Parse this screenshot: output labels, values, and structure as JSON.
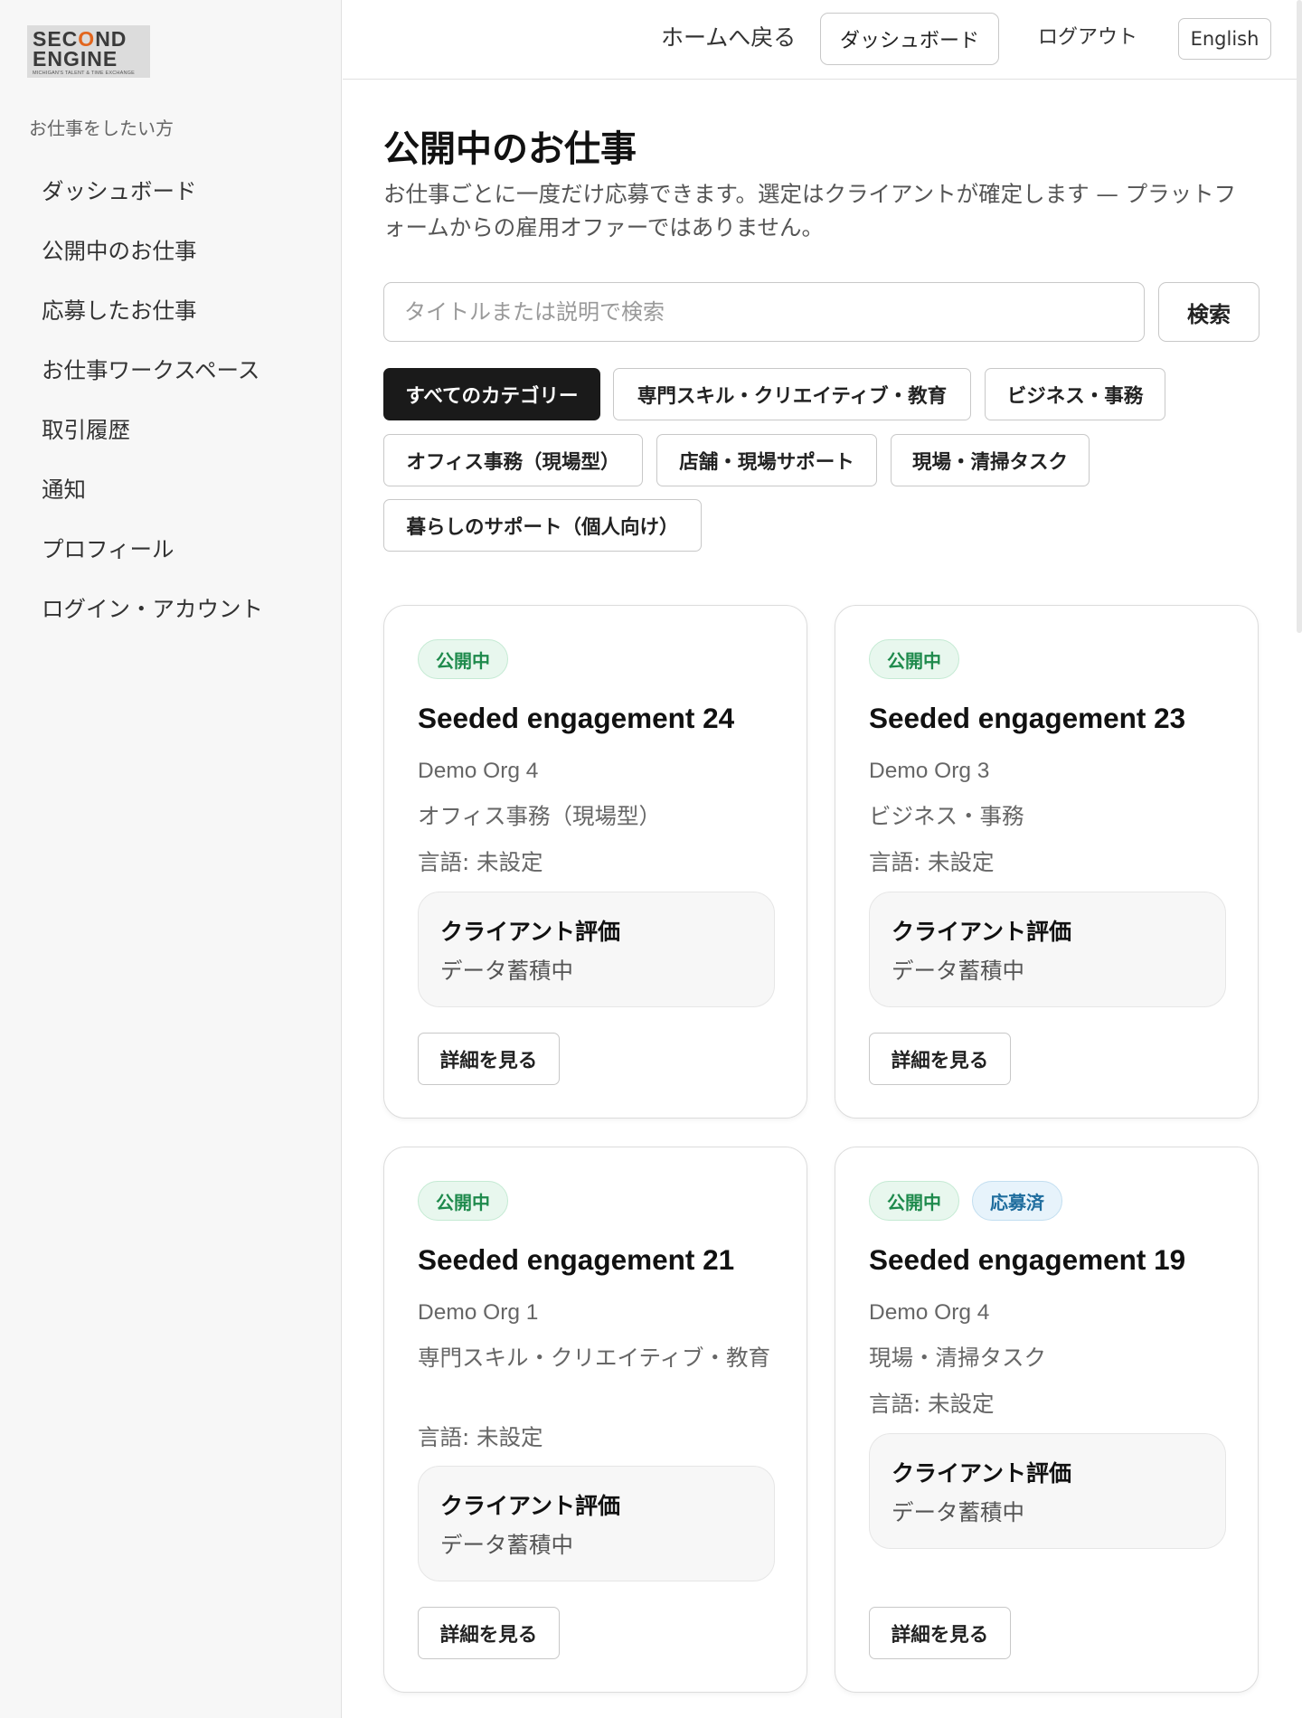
{
  "brand": {
    "line1_a": "SEC",
    "line1_o": "O",
    "line1_b": "ND",
    "line2": "ENGINE",
    "tagline": "MICHIGAN'S TALENT & TIME EXCHANGE"
  },
  "sidebar": {
    "section_label": "お仕事をしたい方",
    "items": [
      {
        "label": "ダッシュボード"
      },
      {
        "label": "公開中のお仕事"
      },
      {
        "label": "応募したお仕事"
      },
      {
        "label": "お仕事ワークスペース"
      },
      {
        "label": "取引履歴"
      },
      {
        "label": "通知"
      },
      {
        "label": "プロフィール"
      },
      {
        "label": "ログイン・アカウント"
      }
    ]
  },
  "topbar": {
    "home_link": "ホームへ戻る",
    "dashboard_button": "ダッシュボード",
    "logout": "ログアウト",
    "language_button": "English"
  },
  "page": {
    "title": "公開中のお仕事",
    "description": "お仕事ごとに一度だけ応募できます。選定はクライアントが確定します — プラットフォームからの雇用オファーではありません。"
  },
  "search": {
    "placeholder": "タイトルまたは説明で検索",
    "value": "",
    "button_label": "検索"
  },
  "categories": [
    {
      "label": "すべてのカテゴリー",
      "active": true
    },
    {
      "label": "専門スキル・クリエイティブ・教育",
      "active": false
    },
    {
      "label": "ビジネス・事務",
      "active": false
    },
    {
      "label": "オフィス事務（現場型）",
      "active": false
    },
    {
      "label": "店舗・現場サポート",
      "active": false
    },
    {
      "label": "現場・清掃タスク",
      "active": false
    },
    {
      "label": "暮らしのサポート（個人向け）",
      "active": false
    }
  ],
  "jobs": [
    {
      "badges": [
        "公開中"
      ],
      "title": "Seeded engagement 24",
      "org": "Demo Org 4",
      "category": "オフィス事務（現場型）",
      "language": "言語: 未設定",
      "rating_label": "クライアント評価",
      "rating_value": "データ蓄積中",
      "detail_button": "詳細を見る"
    },
    {
      "badges": [
        "公開中"
      ],
      "title": "Seeded engagement 23",
      "org": "Demo Org 3",
      "category": "ビジネス・事務",
      "language": "言語: 未設定",
      "rating_label": "クライアント評価",
      "rating_value": "データ蓄積中",
      "detail_button": "詳細を見る"
    },
    {
      "badges": [
        "公開中"
      ],
      "title": "Seeded engagement 21",
      "org": "Demo Org 1",
      "category": "専門スキル・クリエイティブ・教育",
      "language": "言語: 未設定",
      "rating_label": "クライアント評価",
      "rating_value": "データ蓄積中",
      "detail_button": "詳細を見る"
    },
    {
      "badges": [
        "公開中",
        "応募済"
      ],
      "title": "Seeded engagement 19",
      "org": "Demo Org 4",
      "category": "現場・清掃タスク",
      "language": "言語: 未設定",
      "rating_label": "クライアント評価",
      "rating_value": "データ蓄積中",
      "detail_button": "詳細を見る"
    }
  ],
  "colors": {
    "active_chip_bg": "#1a1a1a",
    "open_badge": "#1e8a4c",
    "applied_badge": "#1f6d9e",
    "logo_accent": "#e2661e"
  }
}
